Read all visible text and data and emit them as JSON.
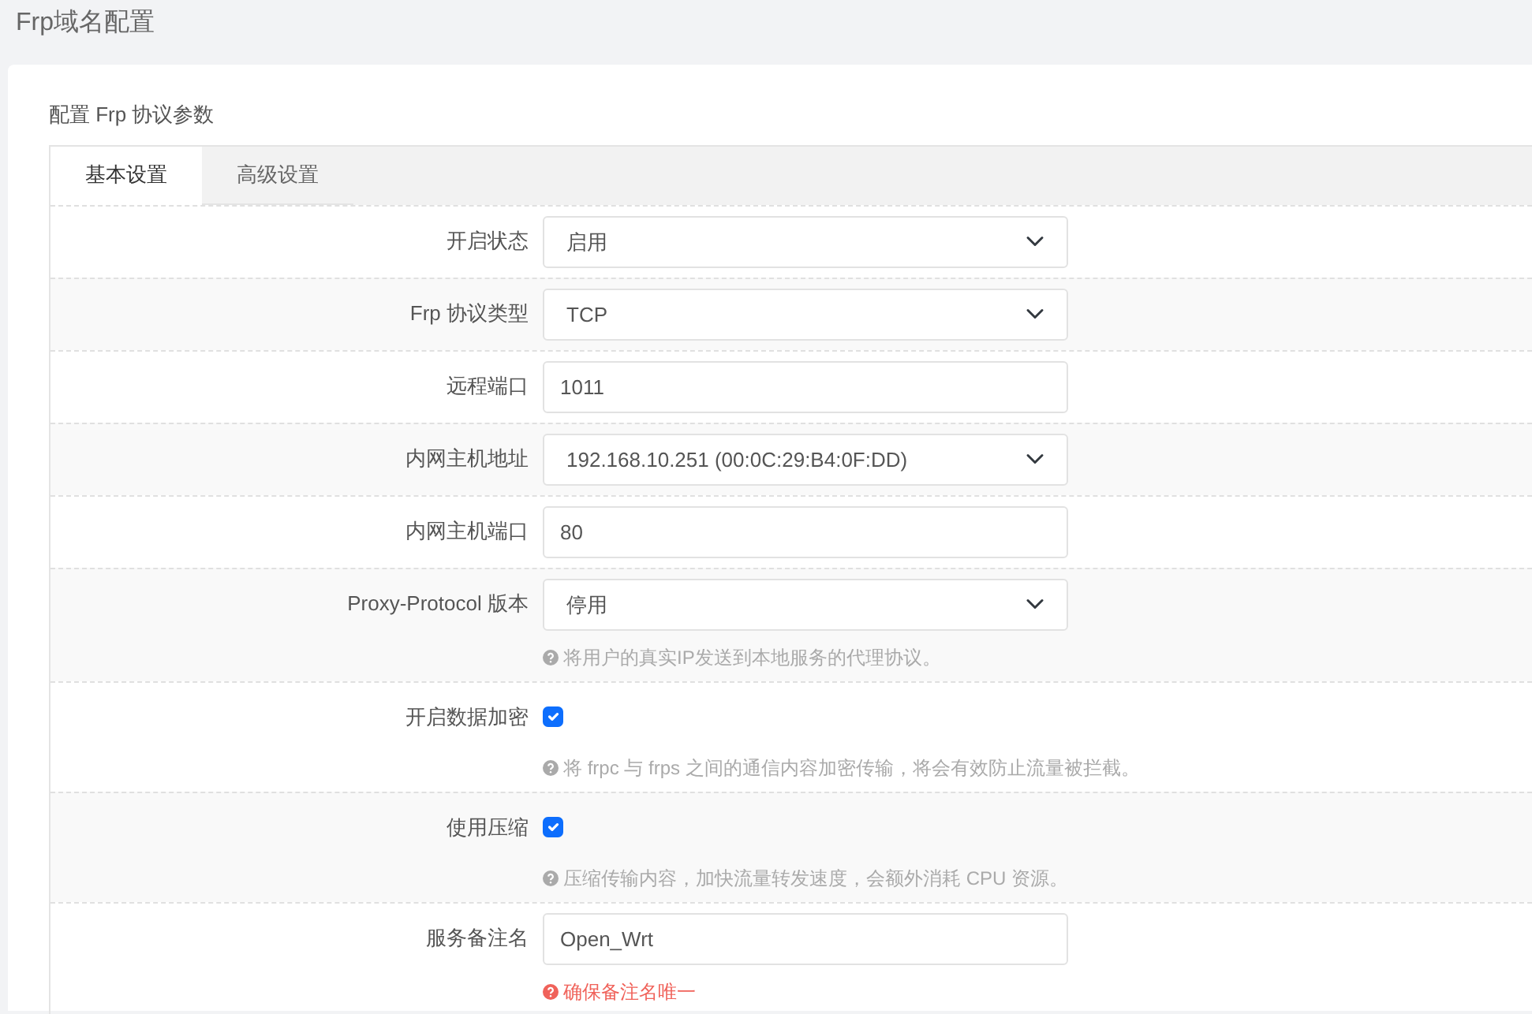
{
  "page_title": "Frp域名配置",
  "section_title": "配置 Frp 协议参数",
  "tabs": [
    {
      "label": "基本设置",
      "selected": true
    },
    {
      "label": "高级设置",
      "selected": false
    }
  ],
  "fields": [
    {
      "label": "开启状态",
      "kind": "select",
      "value": "启用"
    },
    {
      "label": "Frp 协议类型",
      "kind": "select",
      "value": "TCP"
    },
    {
      "label": "远程端口",
      "kind": "input",
      "value": "1011"
    },
    {
      "label": "内网主机地址",
      "kind": "select",
      "value": "192.168.10.251 (00:0C:29:B4:0F:DD)"
    },
    {
      "label": "内网主机端口",
      "kind": "input",
      "value": "80"
    },
    {
      "label": "Proxy-Protocol 版本",
      "kind": "select",
      "value": "停用",
      "help": {
        "text": "将用户的真实IP发送到本地服务的代理协议。",
        "kind": "info"
      }
    },
    {
      "label": "开启数据加密",
      "kind": "checkbox",
      "checked": true,
      "help": {
        "text": "将 frpc 与 frps 之间的通信内容加密传输，将会有效防止流量被拦截。",
        "kind": "info"
      }
    },
    {
      "label": "使用压缩",
      "kind": "checkbox",
      "checked": true,
      "help": {
        "text": "压缩传输内容，加快流量转发速度，会额外消耗 CPU 资源。",
        "kind": "info"
      }
    },
    {
      "label": "服务备注名",
      "kind": "input",
      "value": "Open_Wrt",
      "help": {
        "text": "确保备注名唯一",
        "kind": "warning"
      }
    }
  ]
}
